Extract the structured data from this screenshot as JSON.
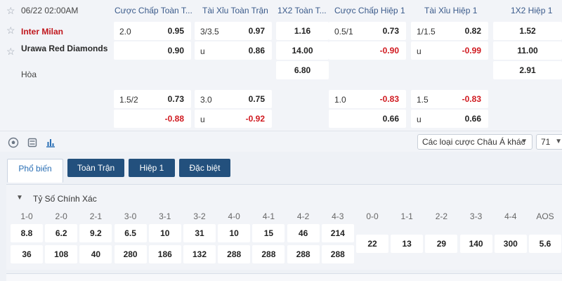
{
  "match": {
    "datetime": "06/22 02:00AM",
    "home": "Inter Milan",
    "away": "Urawa Red Diamonds",
    "draw": "Hòa"
  },
  "headers": [
    "Cược Chấp Toàn T...",
    "Tài Xỉu Toàn Trận",
    "1X2 Toàn T...",
    "Cược Chấp Hiệp 1",
    "Tài Xỉu Hiệp 1",
    "1X2 Hiệp 1"
  ],
  "rows": [
    {
      "hdp_ft": {
        "line": "2.0",
        "home": "0.95",
        "away": "0.90"
      },
      "ou_ft": {
        "line": "3/3.5",
        "over": "0.97",
        "u": "u",
        "under": "0.86"
      },
      "x12_ft": [
        "1.16",
        "14.00",
        "6.80"
      ],
      "hdp_h1": {
        "line": "0.5/1",
        "home": "0.73",
        "away": "-0.90"
      },
      "ou_h1": {
        "line": "1/1.5",
        "over": "0.82",
        "u": "u",
        "under": "-0.99"
      },
      "x12_h1": [
        "1.52",
        "11.00",
        "2.91"
      ]
    },
    {
      "hdp_ft": {
        "line": "1.5/2",
        "home": "0.73",
        "away": "-0.88"
      },
      "ou_ft": {
        "line": "3.0",
        "over": "0.75",
        "u": "u",
        "under": "-0.92"
      },
      "hdp_h1": {
        "line": "1.0",
        "home": "-0.83",
        "away": "0.66"
      },
      "ou_h1": {
        "line": "1.5",
        "over": "-0.83",
        "u": "u",
        "under": "0.66"
      }
    }
  ],
  "toolbar": {
    "select_label": "Các loại cược Châu Á khác",
    "count": "71"
  },
  "tabs": [
    "Phổ biến",
    "Toàn Trận",
    "Hiệp 1",
    "Đặc biệt"
  ],
  "panel": {
    "title": "Tỷ Số Chính Xác",
    "home_scores": [
      {
        "score": "1-0",
        "home": "8.8",
        "away": "36"
      },
      {
        "score": "2-0",
        "home": "6.2",
        "away": "108"
      },
      {
        "score": "2-1",
        "home": "9.2",
        "away": "40"
      },
      {
        "score": "3-0",
        "home": "6.5",
        "away": "280"
      },
      {
        "score": "3-1",
        "home": "10",
        "away": "186"
      },
      {
        "score": "3-2",
        "home": "31",
        "away": "132"
      },
      {
        "score": "4-0",
        "home": "10",
        "away": "288"
      },
      {
        "score": "4-1",
        "home": "15",
        "away": "288"
      },
      {
        "score": "4-2",
        "home": "46",
        "away": "288"
      },
      {
        "score": "4-3",
        "home": "214",
        "away": "288"
      }
    ],
    "draw_scores": [
      {
        "score": "0-0",
        "odds": "22"
      },
      {
        "score": "1-1",
        "odds": "13"
      },
      {
        "score": "2-2",
        "odds": "29"
      },
      {
        "score": "3-3",
        "odds": "140"
      },
      {
        "score": "4-4",
        "odds": "300"
      },
      {
        "score": "AOS",
        "odds": "5.6"
      }
    ]
  },
  "colors": {
    "accent": "#23507d",
    "negative": "#d0191f",
    "home_team": "#c0161c"
  },
  "icons": [
    "star-icon",
    "soccer-ball-icon",
    "list-icon",
    "stats-icon",
    "chevron-down-icon"
  ]
}
